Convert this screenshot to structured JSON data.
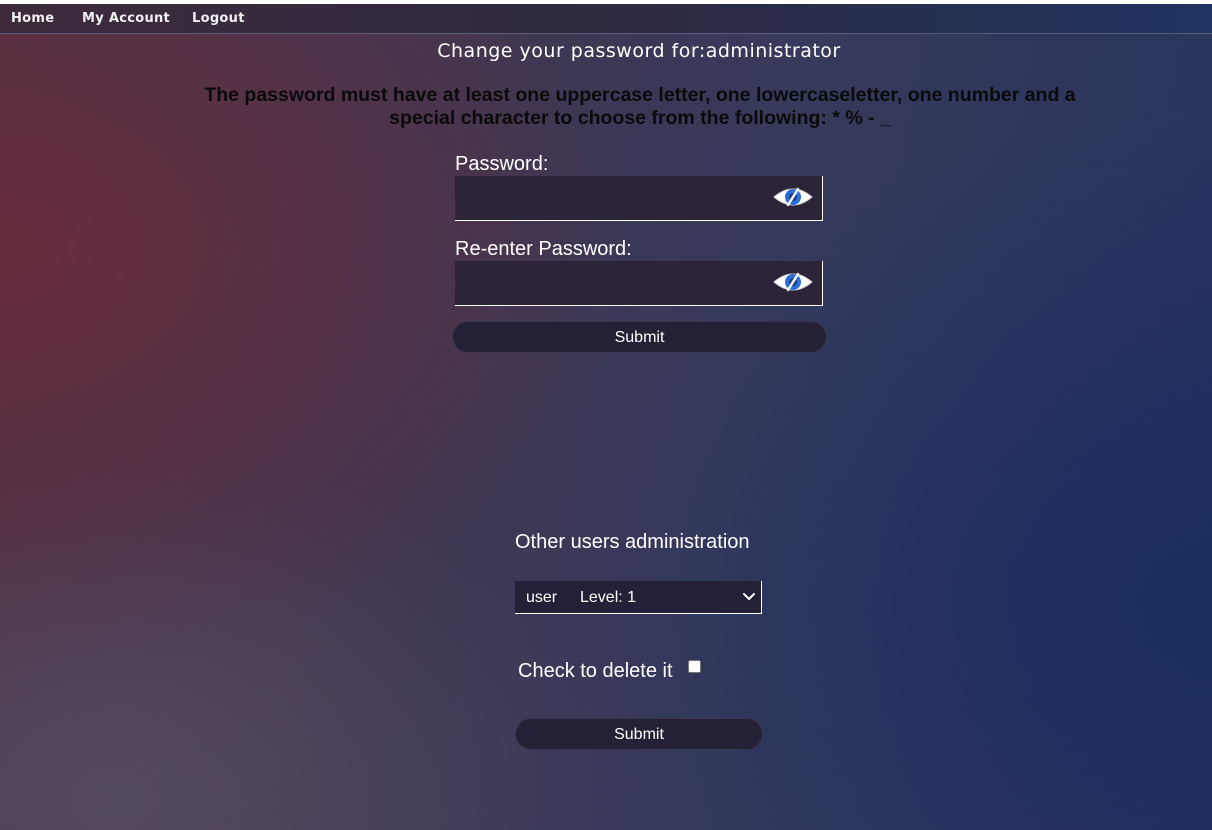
{
  "nav": {
    "home": "Home",
    "account": "My Account",
    "logout": "Logout"
  },
  "page": {
    "title": "Change your password for:administrator",
    "requirements_line1": "The password must have at least one uppercase letter, one lowercaseletter, one number and a",
    "requirements_line2": "special character to choose from the following: * % - _"
  },
  "password_form": {
    "password_label": "Password:",
    "password_value": "",
    "reenter_label": "Re-enter Password:",
    "reenter_value": "",
    "submit_label": "Submit",
    "toggle_icon": "eye-slash-icon"
  },
  "admin_section": {
    "title": "Other users administration",
    "selected_user": "user",
    "selected_level": "Level: 1",
    "delete_label": "Check to delete it",
    "delete_checked": false,
    "submit_label": "Submit"
  },
  "colors": {
    "text": "#ffffff",
    "requirements_text": "#0a0a0a",
    "input_bg": "#2c2539",
    "button_bg": "#242035",
    "eye_icon": "#2a6fd6"
  }
}
